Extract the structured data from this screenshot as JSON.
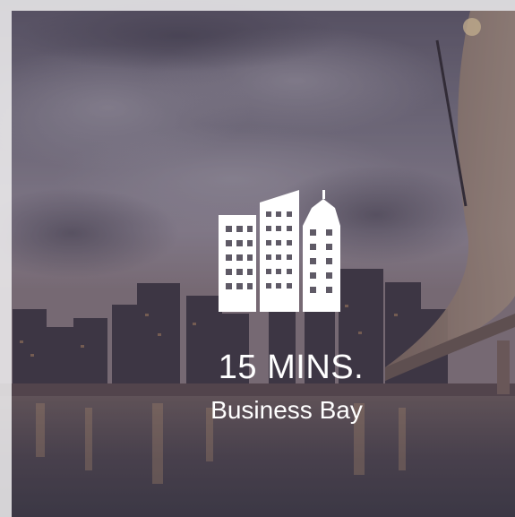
{
  "card": {
    "duration": "15 MINS.",
    "place": "Business Bay",
    "icon": "buildings-icon",
    "colors": {
      "text": "#ffffff",
      "icon": "#ffffff"
    }
  }
}
